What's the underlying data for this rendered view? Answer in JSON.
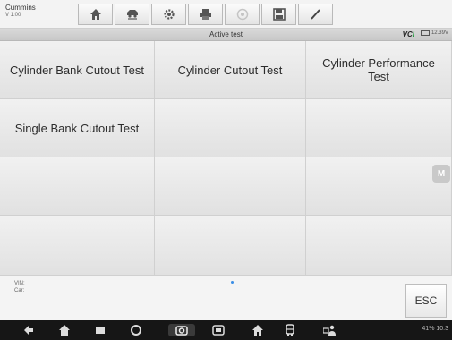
{
  "app": {
    "name": "Cummins",
    "version": "V 1.00"
  },
  "toolbar": {
    "icons": [
      "home-icon",
      "vehicle-swap-icon",
      "settings-icon",
      "print-icon",
      "help-icon",
      "save-icon",
      "pen-icon"
    ]
  },
  "header": {
    "title": "Active test",
    "vci_label_prefix": "VC",
    "vci_label_suffix": "I",
    "battery_text": "12.39V"
  },
  "tests": [
    {
      "label": "Cylinder Bank Cutout Test"
    },
    {
      "label": "Cylinder Cutout Test"
    },
    {
      "label": "Cylinder Performance Test"
    },
    {
      "label": "Single Bank Cutout Test"
    }
  ],
  "side_button": {
    "label": "M"
  },
  "footer": {
    "vin_label": "VIN:",
    "car_label": "Car:",
    "esc_label": "ESC"
  },
  "status": {
    "text": "41%  10:3"
  },
  "colors": {
    "vci_accent": "#1e9d3c",
    "page_dot": "#3a8ee6"
  }
}
